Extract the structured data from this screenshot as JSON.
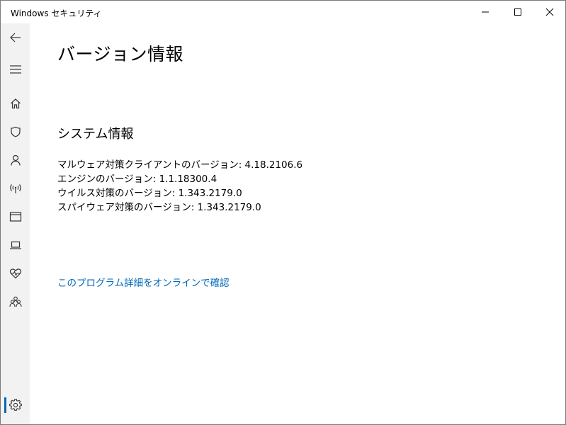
{
  "window": {
    "title": "Windows セキュリティ"
  },
  "title_controls": {
    "minimize_icon": "minimize-icon",
    "maximize_icon": "maximize-icon",
    "close_icon": "close-icon"
  },
  "sidebar": {
    "items": [
      {
        "icon": "back-arrow-icon",
        "name": "back"
      },
      {
        "icon": "hamburger-menu-icon",
        "name": "menu"
      },
      {
        "icon": "home-icon",
        "name": "home"
      },
      {
        "icon": "shield-icon",
        "name": "virus-threat-protection"
      },
      {
        "icon": "person-icon",
        "name": "account-protection"
      },
      {
        "icon": "wireless-icon",
        "name": "firewall-network-protection"
      },
      {
        "icon": "browser-window-icon",
        "name": "app-browser-control"
      },
      {
        "icon": "laptop-icon",
        "name": "device-security"
      },
      {
        "icon": "heart-pulse-icon",
        "name": "device-performance-health"
      },
      {
        "icon": "family-icon",
        "name": "family-options"
      },
      {
        "icon": "gear-icon",
        "name": "settings"
      }
    ],
    "active_item": "settings",
    "accent_color": "#0067b8"
  },
  "main": {
    "page_title": "バージョン情報",
    "section_title": "システム情報",
    "info_lines": [
      "マルウェア対策クライアントのバージョン: 4.18.2106.6",
      "エンジンのバージョン: 1.1.18300.4",
      "ウイルス対策のバージョン: 1.343.2179.0",
      "スパイウェア対策のバージョン: 1.343.2179.0"
    ],
    "online_link": "このプログラム詳細をオンラインで確認",
    "link_color": "#0067b8"
  }
}
